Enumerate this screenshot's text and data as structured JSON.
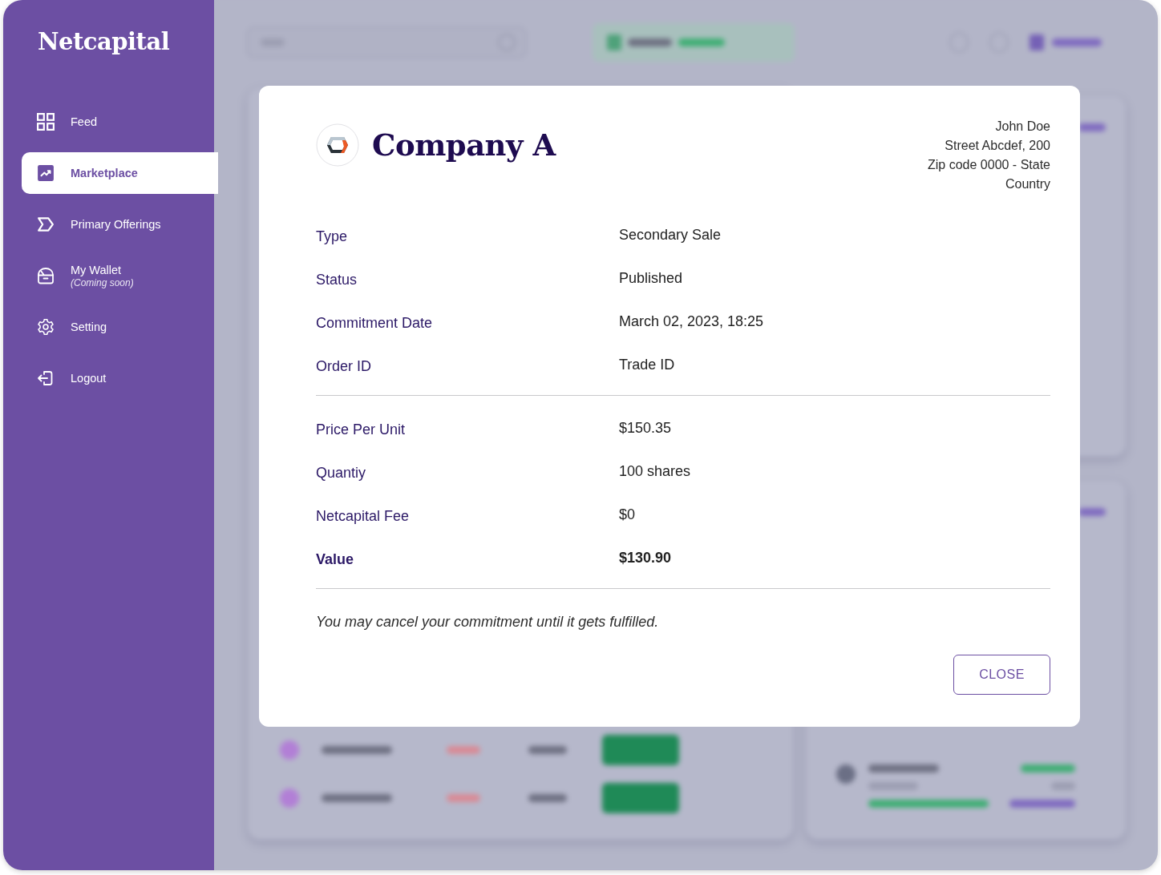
{
  "sidebar": {
    "logo": "Netcapital",
    "items": [
      {
        "label": "Feed",
        "selected": false
      },
      {
        "label": "Marketplace",
        "selected": true
      },
      {
        "label": "Primary Offerings",
        "selected": false
      },
      {
        "label": "My Wallet",
        "note": "(Coming soon)",
        "selected": false
      },
      {
        "label": "Setting",
        "selected": false
      },
      {
        "label": "Logout",
        "selected": false
      }
    ]
  },
  "modal": {
    "company": "Company A",
    "address": [
      "John Doe",
      "Street Abcdef, 200",
      "Zip code 0000 - State",
      "Country"
    ],
    "sections": [
      {
        "rows": [
          {
            "label": "Type",
            "value": "Secondary Sale",
            "kind": "plain"
          },
          {
            "label": "Status",
            "value": "Published",
            "kind": "plain"
          },
          {
            "label": "Commitment Date",
            "value": "March 02, 2023, 18:25",
            "kind": "plain"
          },
          {
            "label": "Order ID",
            "value": "Trade ID",
            "kind": "plain"
          }
        ]
      },
      {
        "rows": [
          {
            "label": "Price Per Unit",
            "value": "$150.35",
            "kind": "plain"
          },
          {
            "label": "Quantiy",
            "value": "100 shares",
            "kind": "plain"
          },
          {
            "label": "Netcapital Fee",
            "value": "$0",
            "kind": "plain"
          },
          {
            "label": "Value",
            "value": "$130.90",
            "kind": "total"
          }
        ]
      }
    ],
    "note": "You may cancel your commitment until it gets fulfilled.",
    "close_button": "CLOSE"
  }
}
